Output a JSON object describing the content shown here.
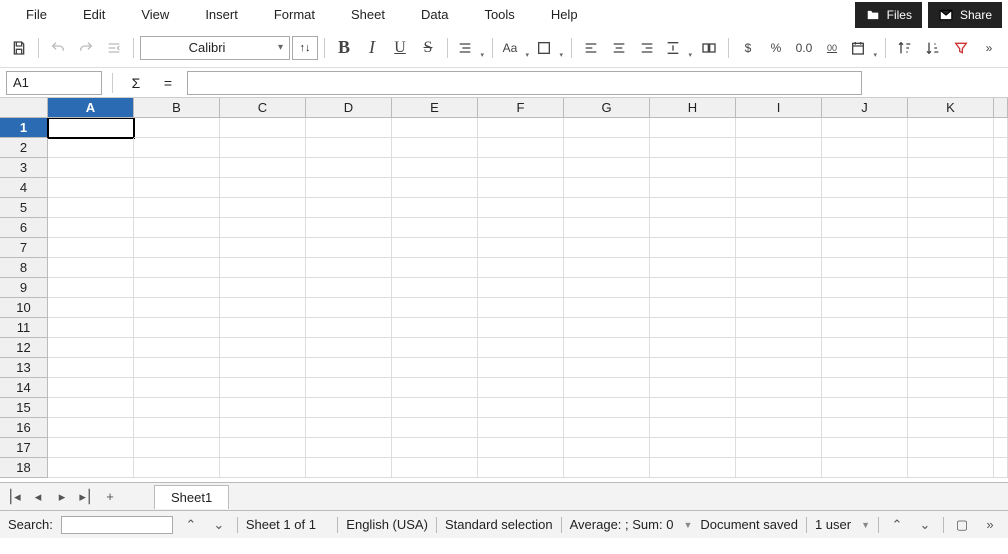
{
  "menus": [
    "File",
    "Edit",
    "View",
    "Insert",
    "Format",
    "Sheet",
    "Data",
    "Tools",
    "Help"
  ],
  "badges": {
    "files": "Files",
    "share": "Share"
  },
  "toolbar": {
    "font": "Calibri",
    "size_btn": "↑↓",
    "bold": "B",
    "italic": "I",
    "underline": "U",
    "strike": "S",
    "case": "Aa",
    "currency": "$",
    "percent": "%",
    "decimal": "0.0",
    "decimal2": "00"
  },
  "formula_bar": {
    "name_box": "A1",
    "sigma": "Σ",
    "eq": "=",
    "value": ""
  },
  "grid": {
    "columns": [
      "A",
      "B",
      "C",
      "D",
      "E",
      "F",
      "G",
      "H",
      "I",
      "J",
      "K"
    ],
    "rows": [
      1,
      2,
      3,
      4,
      5,
      6,
      7,
      8,
      9,
      10,
      11,
      12,
      13,
      14,
      15,
      16,
      17,
      18
    ],
    "active_cell": "A1",
    "selected_col": "A",
    "selected_row": 1
  },
  "tabs": {
    "sheet1": "Sheet1",
    "add": "+"
  },
  "status": {
    "search_label": "Search:",
    "search_value": "",
    "sheet_info": "Sheet 1 of 1",
    "language": "English (USA)",
    "selection": "Standard selection",
    "stats": "Average: ; Sum: 0",
    "saved": "Document saved",
    "user": "1 user",
    "more": "»"
  }
}
